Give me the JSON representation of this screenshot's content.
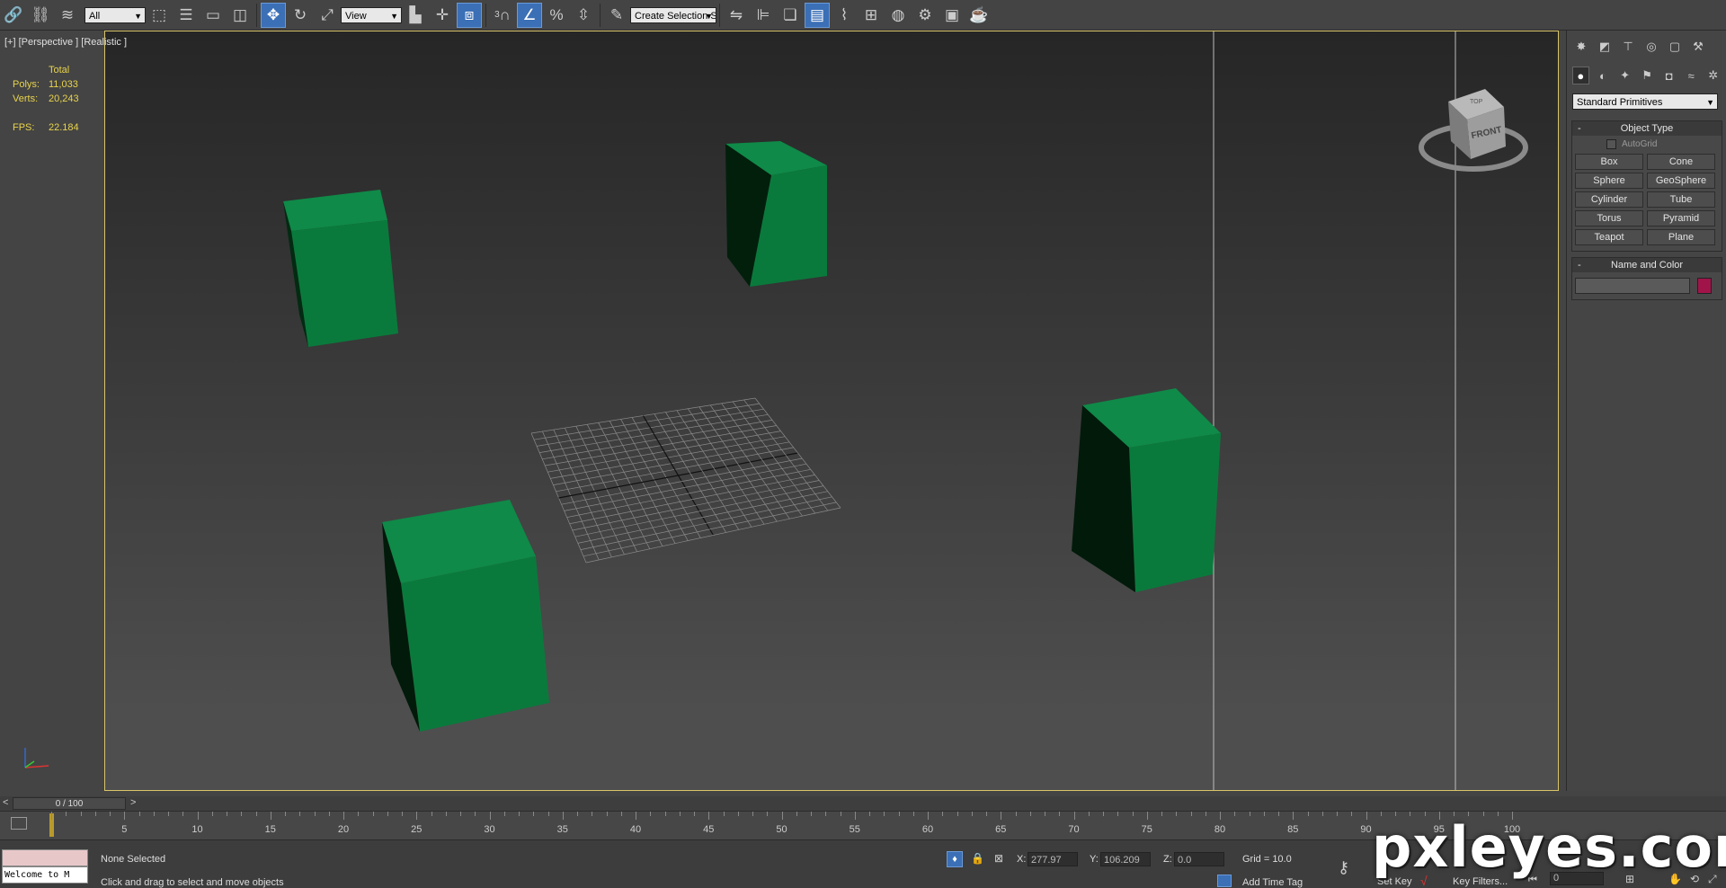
{
  "toolbar": {
    "selection_filter": "All",
    "reference_coord": "View",
    "snap_label": "3",
    "named_selection": "Create Selection Se"
  },
  "viewport": {
    "label": "[+] [Perspective ] [Realistic ]",
    "stats": {
      "total_label": "Total",
      "polys_label": "Polys:",
      "polys_value": "11,033",
      "verts_label": "Verts:",
      "verts_value": "20,243",
      "fps_label": "FPS:",
      "fps_value": "22.184"
    },
    "viewcube_top": "TOP",
    "viewcube_front": "FRONT",
    "object_color": "#0a7a3c"
  },
  "command_panel": {
    "category_dropdown": "Standard Primitives",
    "object_type": {
      "title": "Object Type",
      "autogrid": "AutoGrid",
      "buttons": [
        "Box",
        "Cone",
        "Sphere",
        "GeoSphere",
        "Cylinder",
        "Tube",
        "Torus",
        "Pyramid",
        "Teapot",
        "Plane"
      ]
    },
    "name_color": {
      "title": "Name and Color",
      "name_value": "",
      "swatch": "#a0144a"
    },
    "collapse_glyph": "-"
  },
  "timeline": {
    "slider_label": "0 / 100",
    "prev": "<",
    "next": ">",
    "ticks": [
      "5",
      "10",
      "15",
      "20",
      "25",
      "30",
      "35",
      "40",
      "45",
      "50",
      "55",
      "60",
      "65",
      "70",
      "75",
      "80",
      "85",
      "90",
      "95",
      "100"
    ]
  },
  "status": {
    "maxscript_line": "Welcome to M",
    "selection_status": "None Selected",
    "prompt": "Click and drag to select and move objects",
    "x_label": "X:",
    "x_value": "277.97",
    "y_label": "Y:",
    "y_value": "106.209",
    "z_label": "Z:",
    "z_value": "0.0",
    "grid": "Grid = 10.0",
    "add_time_tag": "Add Time Tag",
    "set_key": "Set Key",
    "key_filters": "Key Filters...",
    "frame_value": "0"
  },
  "watermark": "pxleyes.com"
}
